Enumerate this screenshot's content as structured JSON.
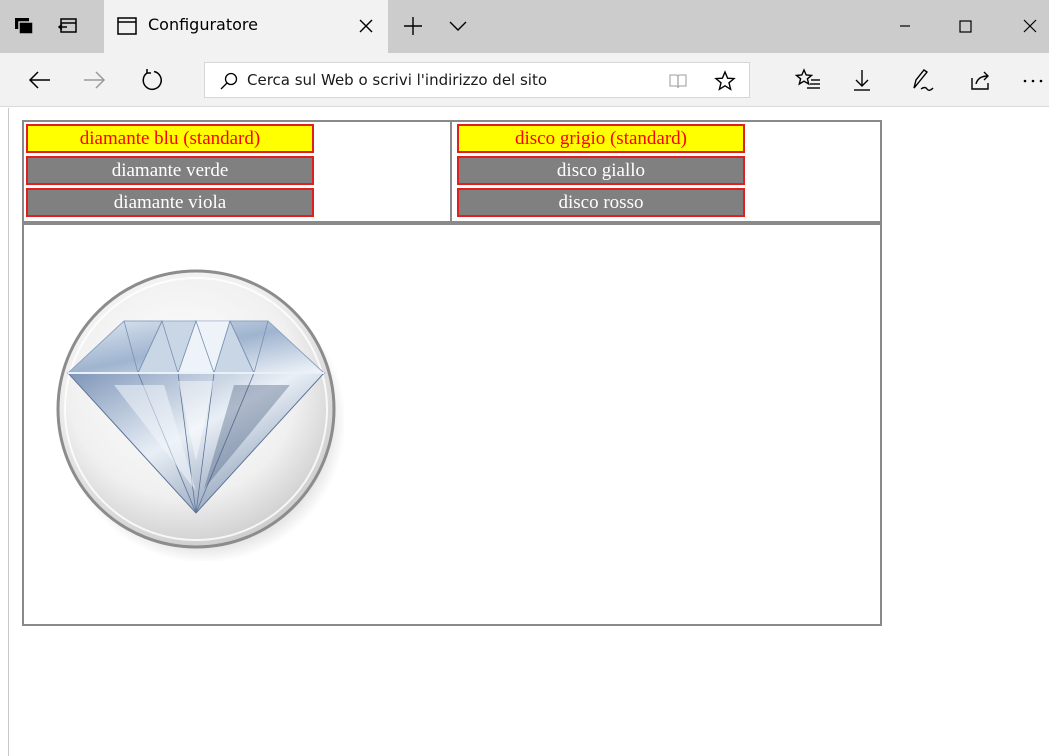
{
  "browser": {
    "tab_title": "Configuratore",
    "address_placeholder": "Cerca sul Web o scrivi l'indirizzo del sito"
  },
  "configurator": {
    "gem_options": [
      {
        "label": "diamante blu (standard)",
        "selected": true
      },
      {
        "label": "diamante verde",
        "selected": false
      },
      {
        "label": "diamante viola",
        "selected": false
      }
    ],
    "disc_options": [
      {
        "label": "disco grigio (standard)",
        "selected": true
      },
      {
        "label": "disco giallo",
        "selected": false
      },
      {
        "label": "disco rosso",
        "selected": false
      }
    ],
    "preview": {
      "gem_color": "blue",
      "disc_color": "grey"
    }
  },
  "colors": {
    "selected_bg": "#ffff00",
    "selected_text": "#ff0000",
    "option_bg": "#808080",
    "option_text": "#ffffff",
    "option_border": "#e02020",
    "table_border": "#8a8a8a"
  }
}
